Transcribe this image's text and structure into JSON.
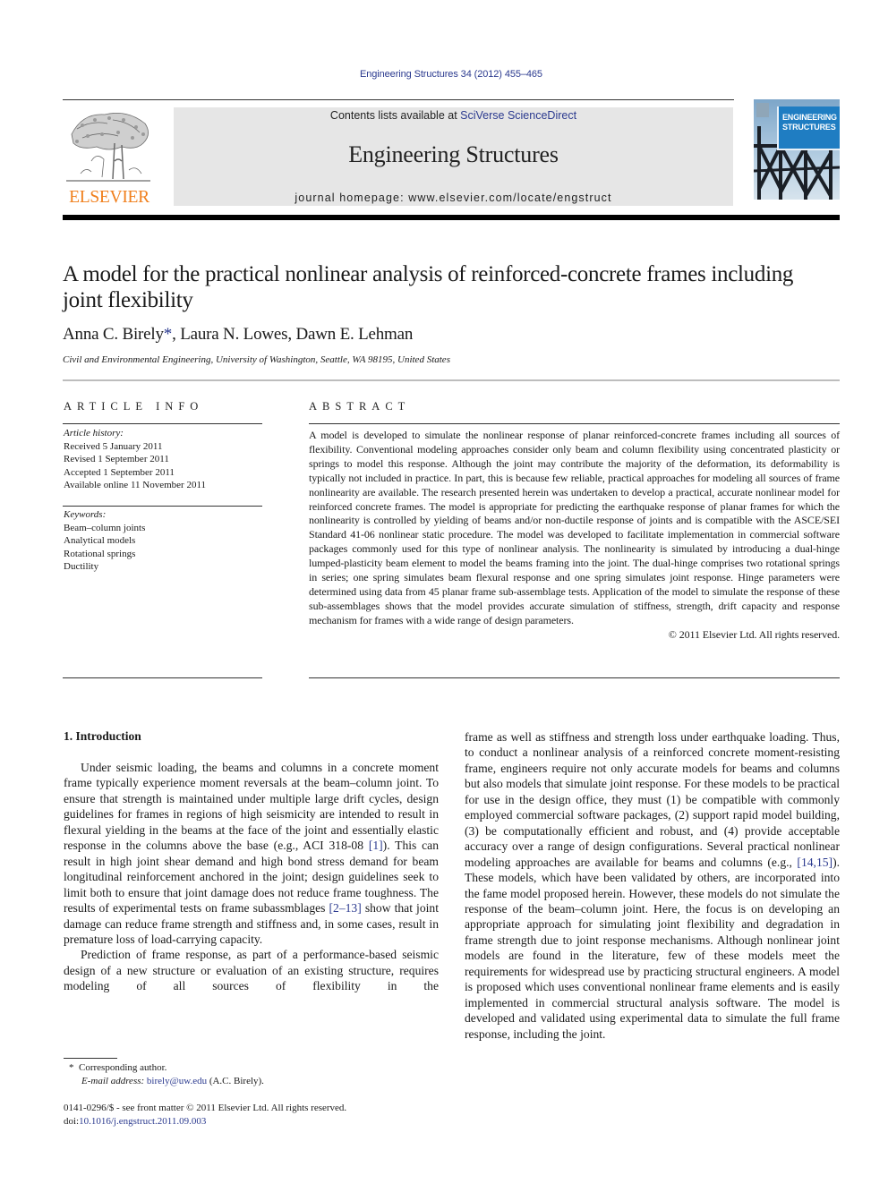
{
  "running_head": "Engineering Structures 34 (2012) 455–465",
  "publisher": {
    "logo_label": "ELSEVIER",
    "logo_color": "#f07f1c"
  },
  "banner": {
    "contents_prefix": "Contents lists available at ",
    "contents_link": "SciVerse ScienceDirect",
    "journal_title": "Engineering Structures",
    "homepage": "journal homepage: www.elsevier.com/locate/engstruct"
  },
  "cover": {
    "line1": "ENGINEERING",
    "line2": "STRUCTURES"
  },
  "article": {
    "title": "A model for the practical nonlinear analysis of reinforced-concrete frames including joint flexibility",
    "authors": [
      {
        "name": "Anna C. Birely",
        "mark": "*"
      },
      {
        "name": "Laura N. Lowes"
      },
      {
        "name": "Dawn E. Lehman"
      }
    ],
    "affiliation": "Civil and Environmental Engineering, University of Washington, Seattle, WA 98195, United States"
  },
  "article_info": {
    "heading": "ARTICLE INFO",
    "history_label": "Article history:",
    "history": [
      "Received 5 January 2011",
      "Revised 1 September 2011",
      "Accepted 1 September 2011",
      "Available online 11 November 2011"
    ],
    "keywords_label": "Keywords:",
    "keywords": [
      "Beam–column joints",
      "Analytical models",
      "Rotational springs",
      "Ductility"
    ]
  },
  "abstract": {
    "heading": "ABSTRACT",
    "text": "A model is developed to simulate the nonlinear response of planar reinforced-concrete frames including all sources of flexibility. Conventional modeling approaches consider only beam and column flexibility using concentrated plasticity or springs to model this response. Although the joint may contribute the majority of the deformation, its deformability is typically not included in practice. In part, this is because few reliable, practical approaches for modeling all sources of frame nonlinearity are available. The research presented herein was undertaken to develop a practical, accurate nonlinear model for reinforced concrete frames. The model is appropriate for predicting the earthquake response of planar frames for which the nonlinearity is controlled by yielding of beams and/or non-ductile response of joints and is compatible with the ASCE/SEI Standard 41-06 nonlinear static procedure. The model was developed to facilitate implementation in commercial software packages commonly used for this type of nonlinear analysis. The nonlinearity is simulated by introducing a dual-hinge lumped-plasticity beam element to model the beams framing into the joint. The dual-hinge comprises two rotational springs in series; one spring simulates beam flexural response and one spring simulates joint response. Hinge parameters were determined using data from 45 planar frame sub-assemblage tests. Application of the model to sim­ulate the response of these sub-assemblages shows that the model provides accurate simulation of stiff­ness, strength, drift capacity and response mechanism for frames with a wide range of design parameters.",
    "copyright": "© 2011 Elsevier Ltd. All rights reserved."
  },
  "body": {
    "section_heading": "1. Introduction",
    "left_p1_a": "Under seismic loading, the beams and columns in a concrete moment frame typically experience moment reversals at the beam–column joint. To ensure that strength is maintained under multiple large drift cycles, design guidelines for frames in regions of high seismicity are intended to result in flexural yielding in the beams at the face of the joint and essentially elastic response in the columns above the base (e.g., ACI 318-08 ",
    "left_p1_ref1": "[1]",
    "left_p1_b": "). This can result in high joint shear demand and high bond stress demand for beam longitudinal reinforcement anchored in the joint; design guidelines seek to limit both to ensure that joint damage does not reduce frame toughness. The results of experimental tests on frame subassmblages ",
    "left_p1_ref2": "[2–13]",
    "left_p1_c": " show that joint damage can reduce frame strength and stiffness and, in some cases, result in premature loss of load-carrying capacity.",
    "left_p2": "Prediction of frame response, as part of a performance-based seismic design of a new structure or evaluation of an existing structure, requires modeling of all sources of flexibility in the",
    "right_a": "frame as well as stiffness and strength loss under earthquake load­ing. Thus, to conduct a nonlinear analysis of a reinforced concrete moment-resisting frame, engineers require not only accurate mod­els for beams and columns but also models that simulate joint re­sponse. For these models to be practical for use in the design office, they must (1) be compatible with commonly employed commer­cial software packages, (2) support rapid model building, (3) be computationally efficient and robust, and (4) provide acceptable accuracy over a range of design configurations. Several practical nonlinear modeling approaches are available for beams and col­umns (e.g., ",
    "right_ref": "[14,15]",
    "right_b": "). These models, which have been validated by others, are incorporated into the fame model proposed herein. However, these models do not simulate the response of the beam–column joint. Here, the focus is on developing an appropri­ate approach for simulating joint flexibility and degradation in frame strength due to joint response mechanisms. Although non­linear joint models are found in the literature, few of these models meet the requirements for widespread use by practicing structural engineers. A model is proposed which uses conventional nonlinear frame elements and is easily implemented in commercial struc­tural analysis software. The model is developed and validated using experimental data to simulate the full frame response, including the joint."
  },
  "footnotes": {
    "star": "*",
    "corresponding": "Corresponding author.",
    "email_label": "E-mail address:",
    "email": "birely@uw.edu",
    "email_suffix": " (A.C. Birely)."
  },
  "front_matter": {
    "issn_line": "0141-0296/$ - see front matter © 2011 Elsevier Ltd. All rights reserved.",
    "doi_prefix": "doi:",
    "doi": "10.1016/j.engstruct.2011.09.003"
  },
  "colors": {
    "link": "#2b3a8f",
    "banner_bg": "#e6e6e6",
    "cover_box": "#1f7dc2"
  }
}
